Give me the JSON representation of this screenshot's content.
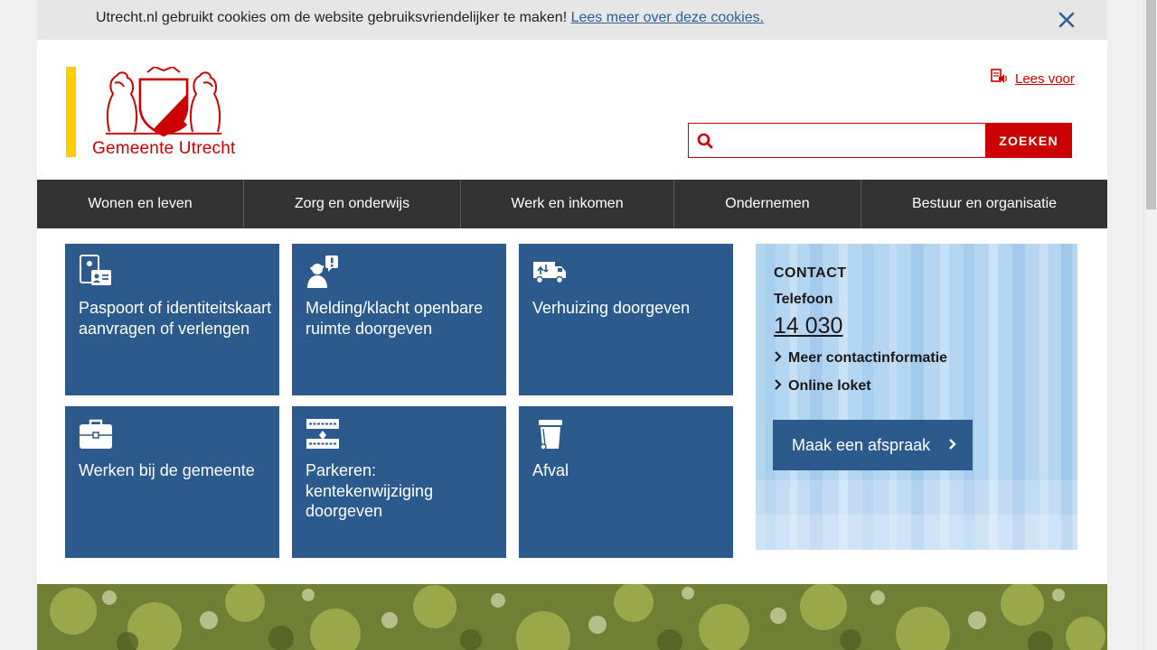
{
  "cookie_bar": {
    "message": "Utrecht.nl gebruikt cookies om de website gebruiksvriendelijker te maken!",
    "link": "Lees meer over deze cookies.",
    "close_icon": "close-icon"
  },
  "header": {
    "logo_name": "Gemeente Utrecht",
    "read_aloud": "Lees voor",
    "search": {
      "placeholder": "",
      "button": "ZOEKEN"
    }
  },
  "nav": [
    "Wonen en leven",
    "Zorg en onderwijs",
    "Werk en inkomen",
    "Ondernemen",
    "Bestuur en organisatie"
  ],
  "tiles": [
    {
      "label": "Paspoort of identiteitskaart aanvragen of verlengen",
      "icon": "id-card-icon"
    },
    {
      "label": "Melding/klacht openbare ruimte doorgeven",
      "icon": "report-person-icon"
    },
    {
      "label": "Verhuizing doorgeven",
      "icon": "moving-truck-icon"
    },
    {
      "label": "Werken bij de gemeente",
      "icon": "briefcase-icon"
    },
    {
      "label": "Parkeren: kentekenwijziging doorgeven",
      "icon": "license-plate-icon"
    },
    {
      "label": "Afval",
      "icon": "trash-bin-icon"
    }
  ],
  "contact": {
    "heading": "CONTACT",
    "phone_label": "Telefoon",
    "phone_number": "14 030",
    "links": [
      "Meer contactinformatie",
      "Online loket"
    ],
    "appointment_button": "Maak een afspraak"
  },
  "colors": {
    "brand_red": "#cc0000",
    "tile_blue": "#2c5a8c",
    "nav_bg": "#333333",
    "accent_yellow": "#ffcd00",
    "contact_bg": "#b8d8f2"
  }
}
